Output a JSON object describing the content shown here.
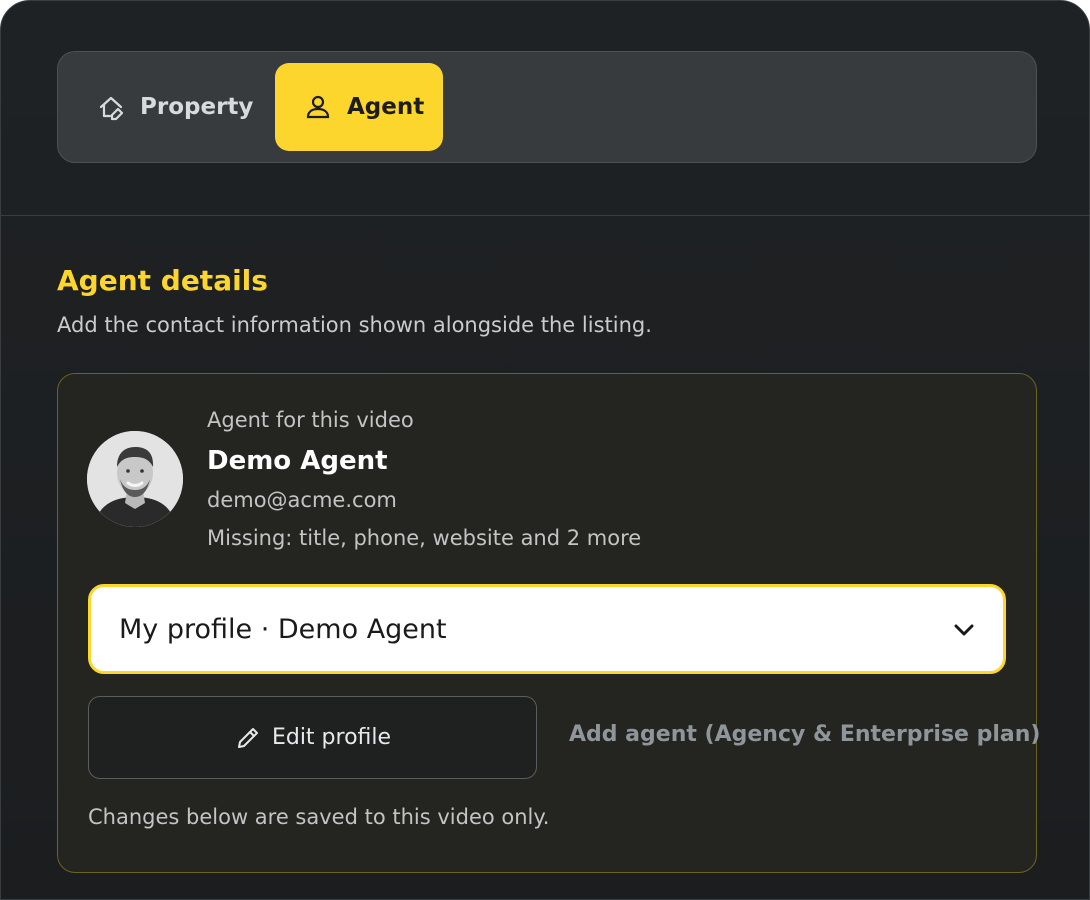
{
  "tabs": {
    "property": {
      "label": "Property",
      "icon": "home-edit-icon",
      "active": false
    },
    "agent": {
      "label": "Agent",
      "icon": "user-icon",
      "active": true
    }
  },
  "section": {
    "title": "Agent details",
    "description": "Add the contact information shown alongside the listing."
  },
  "agent_card": {
    "caption": "Agent for this video",
    "name": "Demo Agent",
    "email": "demo@acme.com",
    "missing": "Missing: title, phone, website and 2 more",
    "avatar_icon": "agent-avatar-photo",
    "select_value": "My profile · Demo Agent",
    "edit_button_label": "Edit profile",
    "add_agent_label": "Add agent (Agency & Enterprise plan)",
    "note": "Changes below are saved to this video only."
  },
  "colors": {
    "accent": "#fdd62d",
    "background": "#1f2224",
    "muted_text": "#c2c4c5",
    "disabled_link": "#8f969b"
  }
}
